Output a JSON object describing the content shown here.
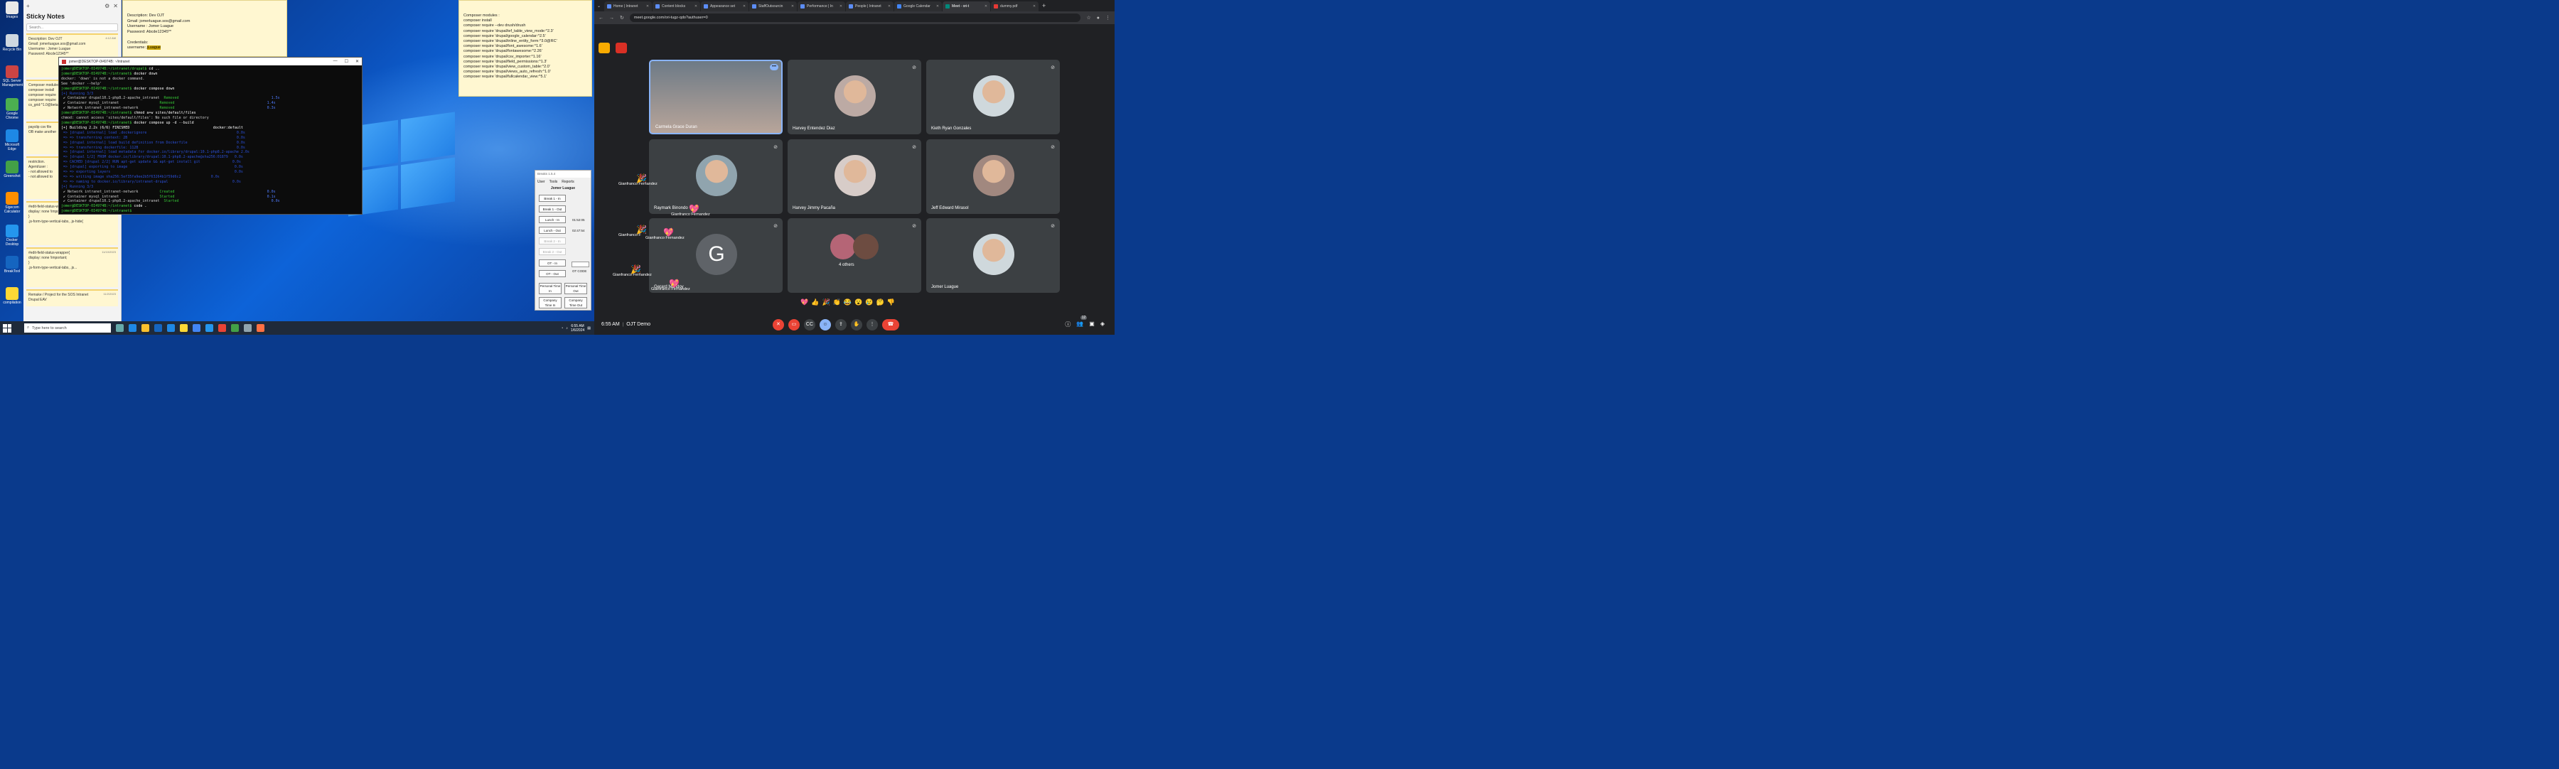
{
  "desktop": {
    "icons": [
      {
        "label": "Images",
        "color": "#e8e8e8"
      },
      {
        "label": "Recycle Bin",
        "color": "#cfd8e0"
      },
      {
        "label": "SQL Server Management",
        "color": "#c44"
      },
      {
        "label": "Google Chrome",
        "color": "#4caf50"
      },
      {
        "label": "Microsoft Edge",
        "color": "#1e88e5"
      },
      {
        "label": "Greenshot",
        "color": "#43a047"
      },
      {
        "label": "Sigecom Calculator",
        "color": "#ff8f00"
      },
      {
        "label": "Docker Desktop",
        "color": "#2496ed"
      },
      {
        "label": "BreakTool",
        "color": "#1565c0"
      },
      {
        "label": "compilation",
        "color": "#fdd835"
      }
    ]
  },
  "sticky": {
    "title": "Sticky Notes",
    "search_placeholder": "Search...",
    "notes": [
      {
        "date": "4:12 AM",
        "lines": [
          "Description: Dev OJT",
          "Gmail: jomerluague.sos@gmail.com",
          "Username : Jomer Luague",
          "Password: Abcde12345**"
        ]
      },
      {
        "date": "",
        "lines": [
          "Composer modules :",
          "composer install",
          "composer require",
          "composer require",
          "cs_grid:^1.0@beta"
        ]
      },
      {
        "date": "",
        "lines": [
          "payslip csv file",
          "OB make another"
        ]
      },
      {
        "date": "",
        "lines": [
          "restriction.",
          "Agent/user :",
          "- not allowed to",
          "- not allowed to"
        ]
      },
      {
        "date": "11/10/2023",
        "lines": [
          "#edit-field-status-wrapper{",
          "   display: none !important;",
          "}",
          ".js-form-type-vertical-tabs, .js-hide{"
        ]
      },
      {
        "date": "11/10/2023",
        "lines": [
          "#edit-field-status-wrapper{",
          "   display: none !important;",
          "}",
          ".js-form-type-vertical-tabs, .js..."
        ]
      },
      {
        "date": "11/2/2023",
        "lines": [
          "Remake / Project for the SOS Intranet",
          "Drupal EAV"
        ]
      }
    ]
  },
  "note1": {
    "lines": [
      "Description: Dev OJT",
      "Gmail: jomerluague.sos@gmail.com",
      "Username : Jomer Luague",
      "Password: Abcde12345**",
      "",
      "Credentials:"
    ],
    "username_label": "username:",
    "username_value": "jLuague"
  },
  "note2": {
    "lines": [
      "Composer modules :",
      "composer install",
      "composer require --dev drush/drush",
      "composer require 'drupal/ief_table_view_mode:^2.3'",
      "composer require 'drupal/google_calendar:^2.5'",
      "composer require 'drupal/inline_entity_form:^3.0@RC'",
      "composer require 'drupal/font_awesome:^1.6'",
      "composer require 'drupal/fontawesome:^2.26'",
      "composer require 'drupal/csv_importer:^1.16'",
      "composer require 'drupal/field_permissions:^1.3'",
      "composer require 'drupal/view_custom_table:^2.0'",
      "composer require 'drupal/views_auto_refresh:^1.0'",
      "composer require 'drupal/fullcalendar_view:^5.1'"
    ]
  },
  "terminal": {
    "title": "jomer@DESKTOP-0I4974B: ~/intranet",
    "lines": [
      {
        "p": "jomer@DESKTOP-0I4974B:~/intranet/drupal$",
        "c": " cd .."
      },
      {
        "p": "jomer@DESKTOP-0I4974B:~/intranet$",
        "c": " docker down"
      },
      {
        "t": "docker: 'down' is not a docker command."
      },
      {
        "t": "See 'docker --help'"
      },
      {
        "p": "jomer@DESKTOP-0I4974B:~/intranet$",
        "c": " docker compose down"
      },
      {
        "b": "[+] Running 3/3"
      },
      {
        "t": " ✔ Container drupal10.1-php8.2-apache_intranet  ",
        "s": "Removed",
        "r": "1.5s"
      },
      {
        "t": " ✔ Container mysql_intranet                   ",
        "s": "Removed",
        "r": "1.4s"
      },
      {
        "t": " ✔ Network intranet_intranet-network          ",
        "s": "Removed",
        "r": "0.3s"
      },
      {
        "p": "jomer@DESKTOP-0I4974B:~/intranet$",
        "c": " chmod a+w sites/default/files"
      },
      {
        "t": "chmod: cannot access 'sites/default/files': No such file or directory"
      },
      {
        "p": "jomer@DESKTOP-0I4974B:~/intranet$",
        "c": " docker compose up -d --build"
      },
      {
        "w": "[+] Building 2.2s (6/6) FINISHED                                       docker:default"
      },
      {
        "b": " => [drupal internal] load .dockerignore                                          0.0s"
      },
      {
        "b": " => => transferring context: 2B                                                   0.0s"
      },
      {
        "b": " => [drupal internal] load build definition from Dockerfile                       0.0s"
      },
      {
        "b": " => => transferring dockerfile: 112B                                              0.0s"
      },
      {
        "b": " => [drupal internal] load metadata for docker.io/library/drupal:10.1-php8.2-apache 2.0s"
      },
      {
        "b": " => [drupal 1/2] FROM docker.io/library/drupal:10.1-php8.2-apache@sha256:01879   0.0s"
      },
      {
        "b": " => CACHED [drupal 2/2] RUN apt-get update && apt-get install git               0.0s"
      },
      {
        "b": " => [drupal] exporting to image                                                  0.0s"
      },
      {
        "b": " => => exporting layers                                                          0.0s"
      },
      {
        "b": " => => writing image sha256:5ef35fa9ee2b5f63264b1f59d6c2              0.0s"
      },
      {
        "b": " => => naming to docker.io/library/intranet-drupal                              0.0s"
      },
      {
        "b": "[+] Running 3/3"
      },
      {
        "t": " ✔ Network intranet_intranet-network          ",
        "s": "Created",
        "r": "0.0s"
      },
      {
        "t": " ✔ Container mysql_intranet                   ",
        "s": "Started",
        "r": "0.1s"
      },
      {
        "t": " ✔ Container drupal10.1-php8.2-apache_intranet  ",
        "s": "Started",
        "r": "0.0s"
      },
      {
        "p": "jomer@DESKTOP-0I4974B:~/intranet$",
        "c": " code ."
      },
      {
        "p": "jomer@DESKTOP-0I4974B:~/intranet$",
        "c": " "
      }
    ]
  },
  "breaks": {
    "title": "Breaks 1.5.4",
    "menu": [
      "User",
      "Tools",
      "Reports"
    ],
    "user": "Jomer Luague",
    "buttons": [
      "Break 1 - In",
      "Break 1 - Out",
      "Lunch - In",
      "Lunch - Out",
      "Break 2 - In",
      "Break 2 - Out",
      "OT - In",
      "OT - Out"
    ],
    "lunch_in_time": "01:52:05",
    "lunch_out_time": "02:47:54",
    "ot_code_label": "OT CODE",
    "personal_in": "Personal Time In",
    "personal_out": "Personal Time Out",
    "company_in": "Company Time In",
    "company_out": "Company Time Out"
  },
  "taskbar": {
    "search_placeholder": "Type here to search",
    "time": "6:55 AM",
    "date": "1/6/2024"
  },
  "chrome": {
    "tabs": [
      {
        "label": "Home | Intranet",
        "color": "#5c8df6"
      },
      {
        "label": "Content blocks",
        "color": "#5c8df6"
      },
      {
        "label": "Appearance set",
        "color": "#5c8df6"
      },
      {
        "label": "StaffOutsourcin",
        "color": "#5c8df6"
      },
      {
        "label": "Performance | In",
        "color": "#5c8df6"
      },
      {
        "label": "People | Intranet",
        "color": "#5c8df6"
      },
      {
        "label": "Google Calendar",
        "color": "#4285f4"
      },
      {
        "label": "Meet - ori-t",
        "color": "#00897b"
      },
      {
        "label": "dummy.pdf",
        "color": "#e53935"
      }
    ],
    "url": "meet.google.com/ori-tugz-qdo?authuser=0"
  },
  "meet": {
    "participants": [
      "Carmela Grace Duran",
      "Harvey Entendez Diaz",
      "Kieth Ryan Gonzales",
      "Raymark Binondo",
      "Harvey Jimmy Pacaña",
      "Jeff Edward Mirasol",
      "Gerard Mondoy",
      "4 others",
      "Jomer Luague"
    ],
    "reaction_names": [
      "Gianfranco Fernandez",
      "Gianfranco Fernandez",
      "Gianfranco F",
      "Gianfranco Fernandez",
      "Gianfranco Fernandez",
      "Gianfranco Fernandez"
    ],
    "gerard_initial": "G",
    "reactions": [
      "💖",
      "👍",
      "🎉",
      "👏",
      "😂",
      "😮",
      "😢",
      "🤔",
      "👎"
    ],
    "time": "6:55 AM",
    "meeting": "OJT Demo",
    "people_count": "12"
  }
}
